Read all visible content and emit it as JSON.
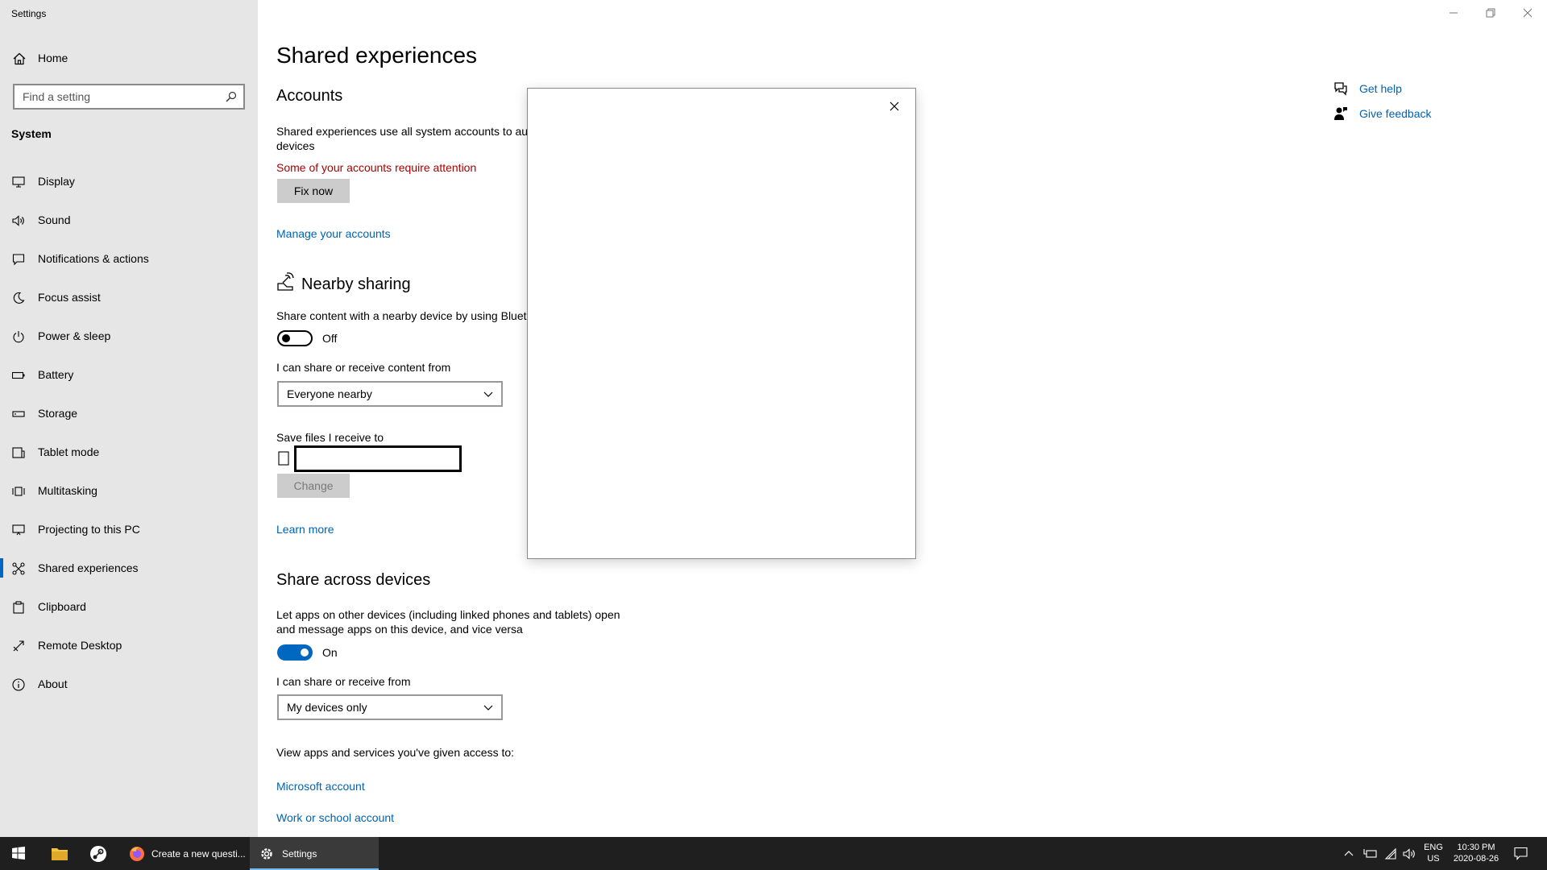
{
  "window": {
    "title": "Settings"
  },
  "sidebar": {
    "home_label": "Home",
    "search_placeholder": "Find a setting",
    "section": "System",
    "items": [
      {
        "label": "Display",
        "icon": "monitor-icon"
      },
      {
        "label": "Sound",
        "icon": "speaker-icon"
      },
      {
        "label": "Notifications & actions",
        "icon": "notification-icon"
      },
      {
        "label": "Focus assist",
        "icon": "moon-icon"
      },
      {
        "label": "Power & sleep",
        "icon": "power-icon"
      },
      {
        "label": "Battery",
        "icon": "battery-icon"
      },
      {
        "label": "Storage",
        "icon": "storage-icon"
      },
      {
        "label": "Tablet mode",
        "icon": "tablet-icon"
      },
      {
        "label": "Multitasking",
        "icon": "multitasking-icon"
      },
      {
        "label": "Projecting to this PC",
        "icon": "projector-icon"
      },
      {
        "label": "Shared experiences",
        "icon": "shared-icon",
        "active": true
      },
      {
        "label": "Clipboard",
        "icon": "clipboard-icon"
      },
      {
        "label": "Remote Desktop",
        "icon": "remote-icon"
      },
      {
        "label": "About",
        "icon": "info-icon"
      }
    ]
  },
  "main": {
    "title": "Shared experiences",
    "accounts": {
      "heading": "Accounts",
      "desc_line1": "Shared experiences use all system accounts to auth",
      "desc_line2": "devices",
      "warning": "Some of your accounts require attention",
      "fix_button": "Fix now",
      "manage_link": "Manage your accounts"
    },
    "nearby": {
      "heading": "Nearby sharing",
      "desc": "Share content with a nearby device by using Blueto",
      "toggle_state": "Off",
      "share_from_label": "I can share or receive content from",
      "share_from_value": "Everyone nearby",
      "save_label": "Save files I receive to",
      "change_button": "Change",
      "learn_more": "Learn more"
    },
    "across": {
      "heading": "Share across devices",
      "desc_line1": "Let apps on other devices (including linked phones and tablets) open",
      "desc_line2": "and message apps on this device, and vice versa",
      "toggle_state": "On",
      "share_from_label": "I can share or receive from",
      "share_from_value": "My devices only",
      "view_label": "View apps and services you've given access to:",
      "link_microsoft": "Microsoft account",
      "link_work": "Work or school account"
    },
    "help": {
      "get_help": "Get help",
      "give_feedback": "Give feedback"
    }
  },
  "taskbar": {
    "apps": [
      {
        "label": "Create a new questi...",
        "icon": "firefox-icon"
      },
      {
        "label": "Settings",
        "icon": "gear-icon",
        "active": true
      }
    ],
    "lang_line1": "ENG",
    "lang_line2": "US",
    "time": "10:30 PM",
    "date": "2020-08-26"
  },
  "colors": {
    "accent": "#0067c0",
    "link": "#0063b1",
    "warning": "#a80000",
    "sidebar_bg": "#e6e6e6",
    "taskbar_bg": "#1f1f1f"
  }
}
